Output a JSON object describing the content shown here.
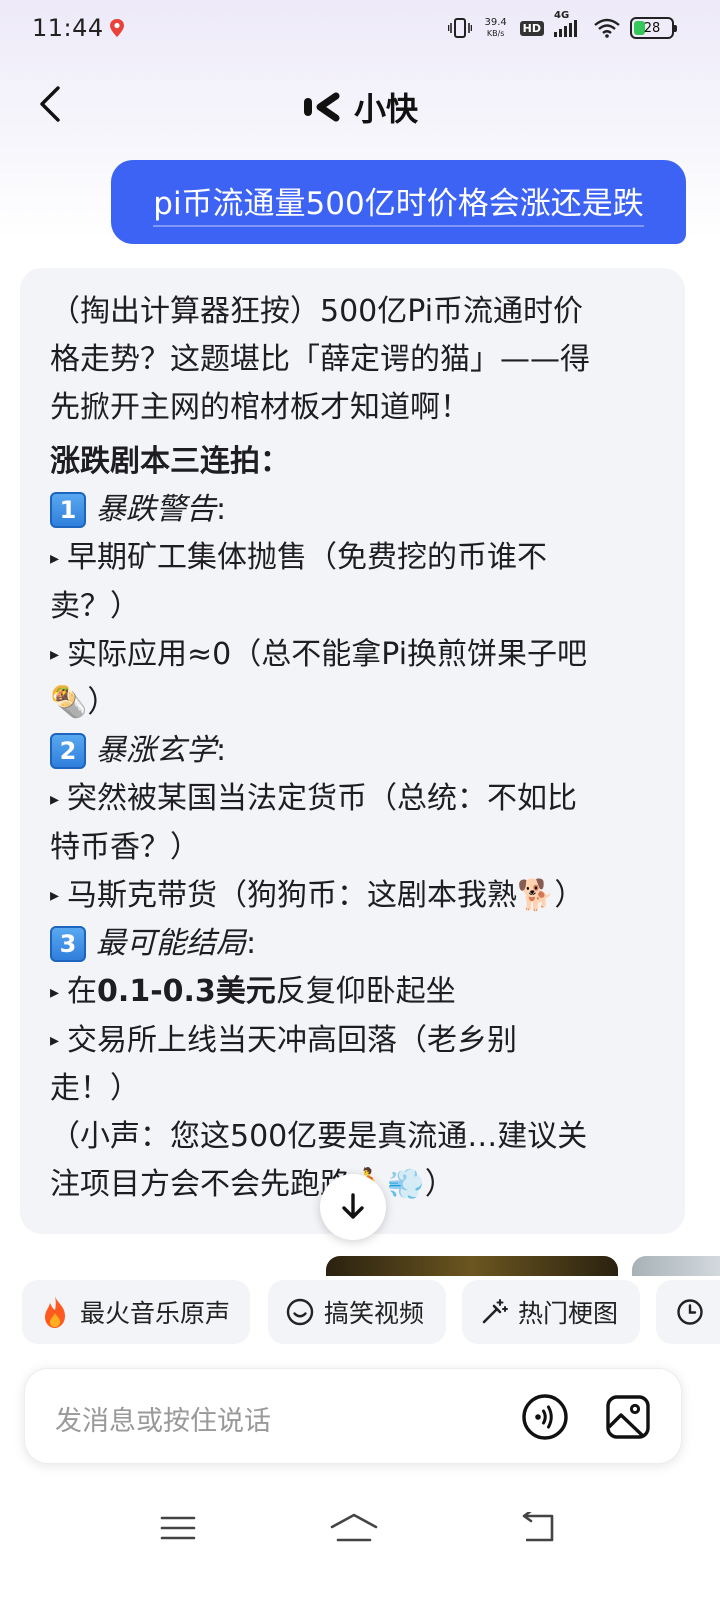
{
  "status_bar": {
    "time": "11:44",
    "net_speed_value": "39.4",
    "net_speed_unit": "KB/s",
    "hd": "HD",
    "network": "4G",
    "battery_level": "28"
  },
  "header": {
    "title": "小快"
  },
  "chat": {
    "user_message": "pi币流通量500亿时价格会涨还是跌",
    "ai": {
      "intro_lines": [
        "（掏出计算器狂按）500亿Pi币流通时价",
        "格走势？这题堪比「薛定谔的猫」——得",
        "先掀开主网的棺材板才知道啊！"
      ],
      "heading": "涨跌剧本三连拍：",
      "sections": [
        {
          "num": "1",
          "title": "暴跌警告",
          "colon": ":",
          "bullets": [
            [
              "早期矿工集体抛售（免费挖的币谁不",
              "卖？）"
            ],
            [
              "实际应用≈0（总不能拿Pi换煎饼果子吧",
              "🌯）"
            ]
          ]
        },
        {
          "num": "2",
          "title": "暴涨玄学",
          "colon": ":",
          "bullets": [
            [
              "突然被某国当法定货币（总统：不如比",
              "特币香？）"
            ],
            [
              "马斯克带货（狗狗币：这剧本我熟🐕）"
            ]
          ]
        },
        {
          "num": "3",
          "title": "最可能结局",
          "colon": ":",
          "bullets": [
            [
              "在0.1-0.3美元反复仰卧起坐"
            ],
            [
              "交易所上线当天冲高回落（老乡别",
              "走！）"
            ]
          ]
        }
      ],
      "price_bold": "0.1-0.3美元",
      "price_prefix": "在",
      "price_suffix": "反复仰卧起坐",
      "outro_lines": [
        "（小声：您这500亿要是真流通…建议关",
        "注项目方会不会先跑路🏃💨）"
      ]
    }
  },
  "chips": [
    {
      "icon": "fire-icon",
      "label": "最火音乐原声"
    },
    {
      "icon": "smile-icon",
      "label": "搞笑视频"
    },
    {
      "icon": "magic-wand-icon",
      "label": "热门梗图"
    }
  ],
  "input": {
    "placeholder": "发消息或按住说话"
  },
  "colors": {
    "accent": "#3d63f5",
    "bubble_bg": "#f3f4f8",
    "battery": "#35c759"
  }
}
